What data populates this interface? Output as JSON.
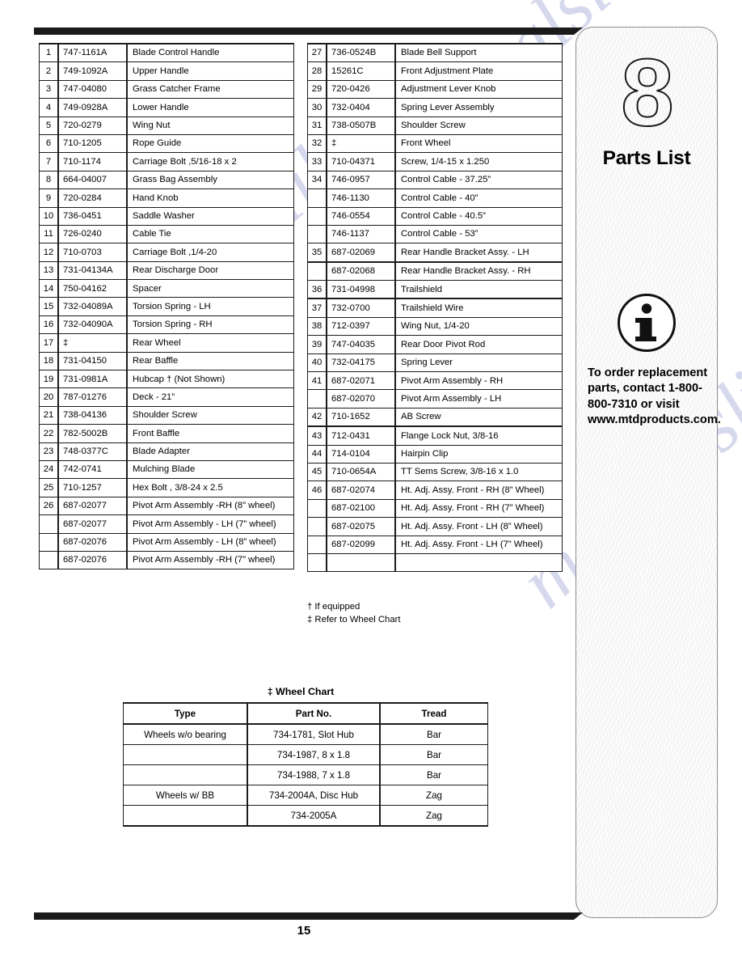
{
  "page": {
    "number": "15"
  },
  "sidebar": {
    "chapter_number": "8",
    "title": "Parts List",
    "info_icon": "information-icon",
    "note": "To order replacement parts, contact 1-800-800-7310 or visit www.mtdproducts.com."
  },
  "watermark": {
    "text": "manualslib.com",
    "color": "#c9cce8"
  },
  "parts_list": {
    "left": [
      {
        "idx": "1",
        "part_no": "747-1161A",
        "description": "Blade Control Handle"
      },
      {
        "idx": "2",
        "part_no": "749-1092A",
        "description": "Upper Handle"
      },
      {
        "idx": "3",
        "part_no": "747-04080",
        "description": "Grass Catcher Frame"
      },
      {
        "idx": "4",
        "part_no": "749-0928A",
        "description": "Lower Handle"
      },
      {
        "idx": "5",
        "part_no": "720-0279",
        "description": "Wing Nut"
      },
      {
        "idx": "6",
        "part_no": "710-1205",
        "description": "Rope Guide"
      },
      {
        "idx": "7",
        "part_no": "710-1174",
        "description": "Carriage Bolt ,5/16-18 x 2"
      },
      {
        "idx": "8",
        "part_no": "664-04007",
        "description": "Grass Bag Assembly"
      },
      {
        "idx": "9",
        "part_no": "720-0284",
        "description": "Hand Knob"
      },
      {
        "idx": "10",
        "part_no": "736-0451",
        "description": "Saddle Washer"
      },
      {
        "idx": "11",
        "part_no": "726-0240",
        "description": "Cable Tie"
      },
      {
        "idx": "12",
        "part_no": "710-0703",
        "description": "Carriage Bolt ,1/4-20"
      },
      {
        "idx": "13",
        "part_no": "731-04134A",
        "description": "Rear Discharge Door"
      },
      {
        "idx": "14",
        "part_no": "750-04162",
        "description": "Spacer"
      },
      {
        "idx": "15",
        "part_no": "732-04089A",
        "description": "Torsion Spring - LH"
      },
      {
        "idx": "16",
        "part_no": "732-04090A",
        "description": "Torsion Spring - RH"
      },
      {
        "idx": "17",
        "part_no": "‡",
        "description": "Rear Wheel"
      },
      {
        "idx": "18",
        "part_no": "731-04150",
        "description": "Rear Baffle"
      },
      {
        "idx": "19",
        "part_no": "731-0981A",
        "description": "Hubcap † (Not Shown)"
      },
      {
        "idx": "20",
        "part_no": "787-01276",
        "description": "Deck - 21”"
      },
      {
        "idx": "21",
        "part_no": "738-04136",
        "description": "Shoulder Screw"
      },
      {
        "idx": "22",
        "part_no": "782-5002B",
        "description": "Front Baffle"
      },
      {
        "idx": "23",
        "part_no": "748-0377C",
        "description": "Blade Adapter"
      },
      {
        "idx": "24",
        "part_no": "742-0741",
        "description": "Mulching Blade"
      },
      {
        "idx": "25",
        "part_no": "710-1257",
        "description": "Hex Bolt , 3/8-24 x 2.5"
      },
      {
        "idx": "26",
        "part_no": "687-02077",
        "description": "Pivot Arm Assembly -RH (8” wheel)"
      },
      {
        "idx": "",
        "part_no": "687-02077",
        "description": "Pivot Arm Assembly - LH (7” wheel)"
      },
      {
        "idx": "",
        "part_no": "687-02076",
        "description": "Pivot Arm Assembly - LH (8” wheel)"
      },
      {
        "idx": "",
        "part_no": "687-02076",
        "description": "Pivot Arm Assembly -RH (7” wheel)"
      }
    ],
    "right": [
      {
        "idx": "27",
        "part_no": "736-0524B",
        "description": "Blade Bell Support"
      },
      {
        "idx": "28",
        "part_no": "15261C",
        "description": "Front Adjustment Plate"
      },
      {
        "idx": "29",
        "part_no": "720-0426",
        "description": "Adjustment Lever Knob"
      },
      {
        "idx": "30",
        "part_no": "732-0404",
        "description": "Spring Lever Assembly"
      },
      {
        "idx": "31",
        "part_no": "738-0507B",
        "description": "Shoulder Screw"
      },
      {
        "idx": "32",
        "part_no": "‡",
        "description": "Front Wheel"
      },
      {
        "idx": "33",
        "part_no": "710-04371",
        "description": "Screw, 1/4-15 x 1.250"
      },
      {
        "idx": "34",
        "part_no": "746-0957",
        "description": "Control Cable - 37.25”"
      },
      {
        "idx": "",
        "part_no": "746-1130",
        "description": "Control Cable - 40”"
      },
      {
        "idx": "",
        "part_no": "746-0554",
        "description": "Control Cable - 40.5”"
      },
      {
        "idx": "",
        "part_no": "746-1137",
        "description": "Control Cable - 53”"
      },
      {
        "idx": "35",
        "part_no": "687-02069",
        "description": "Rear Handle Bracket Assy. - LH"
      },
      {
        "idx": "",
        "part_no": "687-02068",
        "description": "Rear Handle Bracket Assy. - RH"
      },
      {
        "idx": "36",
        "part_no": "731-04998",
        "description": "Trailshield"
      },
      {
        "idx": "37",
        "part_no": "732-0700",
        "description": "Trailshield Wire"
      },
      {
        "idx": "38",
        "part_no": "712-0397",
        "description": "Wing Nut, 1/4-20"
      },
      {
        "idx": "39",
        "part_no": "747-04035",
        "description": "Rear Door Pivot Rod"
      },
      {
        "idx": "40",
        "part_no": "732-04175",
        "description": "Spring Lever"
      },
      {
        "idx": "41",
        "part_no": "687-02071",
        "description": "Pivot Arm Assembly - RH"
      },
      {
        "idx": "",
        "part_no": "687-02070",
        "description": "Pivot Arm Assembly - LH"
      },
      {
        "idx": "42",
        "part_no": "710-1652",
        "description": "AB Screw"
      },
      {
        "idx": "43",
        "part_no": "712-0431",
        "description": "Flange Lock Nut, 3/8-16"
      },
      {
        "idx": "44",
        "part_no": "714-0104",
        "description": "Hairpin Clip"
      },
      {
        "idx": "45",
        "part_no": "710-0654A",
        "description": "TT Sems Screw, 3/8-16 x 1.0"
      },
      {
        "idx": "46",
        "part_no": "687-02074",
        "description": "Ht. Adj. Assy. Front - RH (8” Wheel)"
      },
      {
        "idx": "",
        "part_no": "687-02100",
        "description": "Ht. Adj. Assy. Front - RH (7” Wheel)"
      },
      {
        "idx": "",
        "part_no": "687-02075",
        "description": "Ht. Adj. Assy. Front - LH (8” Wheel)"
      },
      {
        "idx": "",
        "part_no": "687-02099",
        "description": "Ht. Adj. Assy. Front - LH (7” Wheel)"
      },
      {
        "idx": "",
        "part_no": "",
        "description": ""
      }
    ]
  },
  "footnotes": {
    "line1": "† If equipped",
    "line2": "‡ Refer to Wheel Chart"
  },
  "wheel_chart": {
    "title": "‡ Wheel Chart",
    "headers": [
      "Type",
      "Part No.",
      "Tread"
    ],
    "rows": [
      {
        "type": "Wheels w/o bearing",
        "part_no": "734-1781, Slot Hub",
        "tread": "Bar"
      },
      {
        "type": "",
        "part_no": "734-1987, 8 x 1.8",
        "tread": "Bar"
      },
      {
        "type": "",
        "part_no": "734-1988, 7 x 1.8",
        "tread": "Bar"
      },
      {
        "type": "Wheels w/ BB",
        "part_no": "734-2004A, Disc Hub",
        "tread": "Zag"
      },
      {
        "type": "",
        "part_no": "734-2005A",
        "tread": "Zag"
      }
    ]
  }
}
